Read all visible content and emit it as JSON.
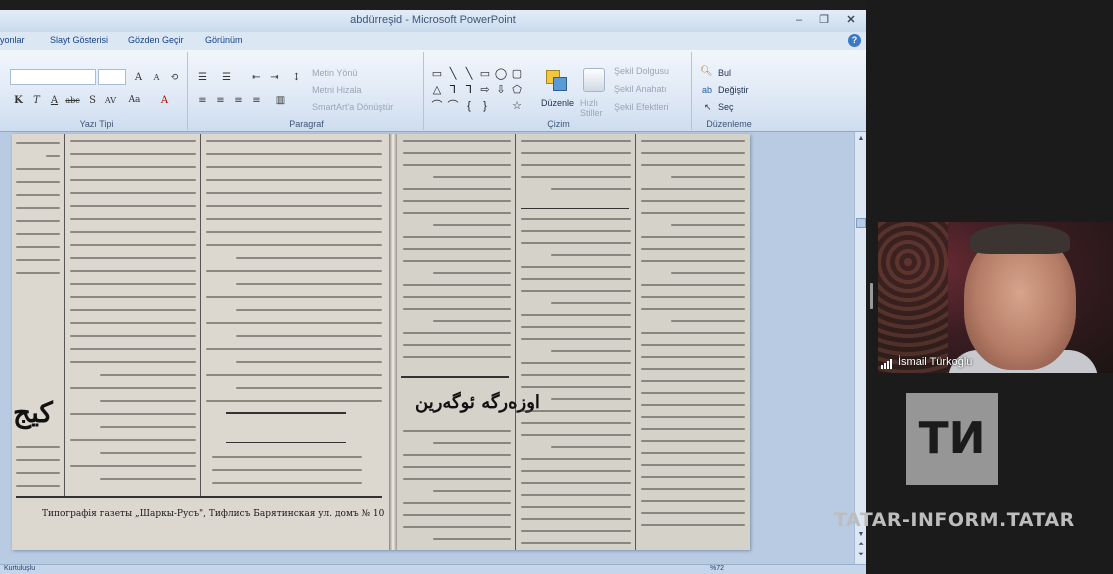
{
  "window": {
    "title": "abdürreşid - Microsoft PowerPoint",
    "minimize_icon": "minimize-icon",
    "maximize_icon": "restore-icon",
    "close_icon": "close-icon"
  },
  "menu": [
    "yonlar",
    "Slayt Gösterisi",
    "Gözden Geçir",
    "Görünüm"
  ],
  "ribbon": {
    "font_group_label": "Yazı Tipi",
    "paragraph_group_label": "Paragraf",
    "drawing_group_label": "Çizim",
    "editing_group_label": "Düzenleme",
    "text_direction": "Metin Yönü",
    "align_text": "Metni Hizala",
    "smartart": "SmartArt'a Dönüştür",
    "arrange": "Düzenle",
    "quick_styles": "Hızlı Stiller",
    "shape_fill": "Şekil Dolgusu",
    "shape_outline": "Şekil Anahatı",
    "shape_effects": "Şekil Efektleri",
    "find": "Bul",
    "replace": "Değiştir",
    "select": "Seç"
  },
  "slide": {
    "masthead": "اوزەرگە ئوگەرین",
    "imprint": "Типографія газеты „Шаркы-Русъ\", Тифлисъ Барятинская ул. домъ № 10",
    "left_big_glyph": "کیج"
  },
  "status": {
    "left": "Kurtuluşlu",
    "zoom": "%72"
  },
  "video": {
    "participant_name": "İsmail Türkoğlu"
  },
  "watermark": {
    "logo": "ТИ",
    "site": "TATAR-INFORM.TATAR"
  }
}
